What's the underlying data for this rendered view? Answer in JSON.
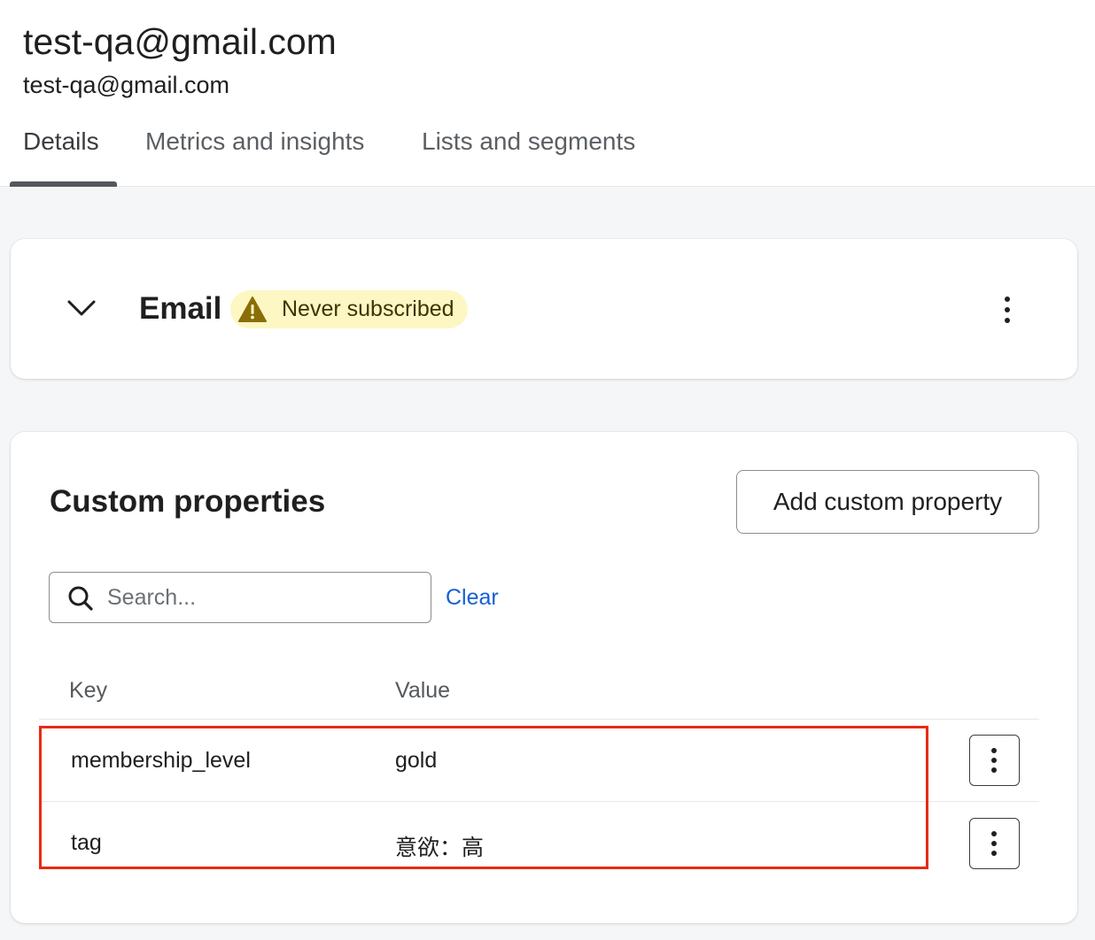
{
  "header": {
    "title": "test-qa@gmail.com",
    "subtitle": "test-qa@gmail.com",
    "tabs": [
      {
        "label": "Details",
        "active": true
      },
      {
        "label": "Metrics and insights",
        "active": false
      },
      {
        "label": "Lists and segments",
        "active": false
      }
    ]
  },
  "email_card": {
    "label": "Email",
    "status_badge": "Never subscribed",
    "badge_icon": "warning-icon",
    "colors": {
      "badge_bg": "#fdf7c3",
      "badge_icon": "#8a6d06"
    }
  },
  "custom_properties": {
    "title": "Custom properties",
    "add_button": "Add custom property",
    "search_placeholder": "Search...",
    "clear_label": "Clear",
    "columns": [
      "Key",
      "Value"
    ],
    "rows": [
      {
        "key": "membership_level",
        "value": "gold"
      },
      {
        "key": "tag",
        "value": "意欲：高"
      }
    ],
    "highlight_color": "#ea2a12",
    "link_color": "#1560d4"
  }
}
